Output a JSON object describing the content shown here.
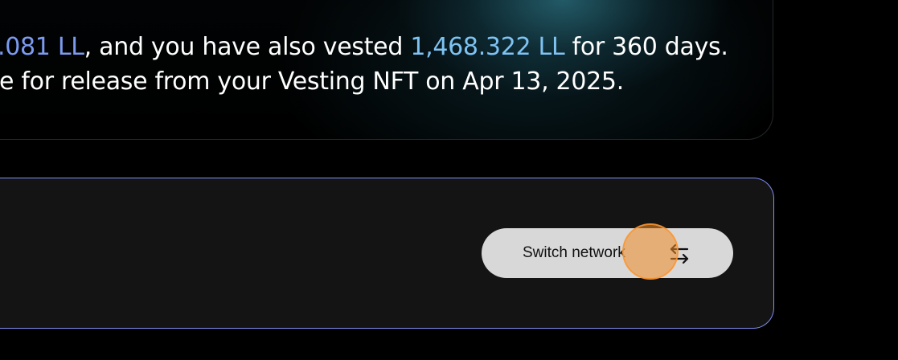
{
  "vesting_info": {
    "line1": {
      "amount_a": ".081 LL",
      "text_a": ", and you have also vested ",
      "amount_b": "1,468.322 LL",
      "text_b": " for 360 days."
    },
    "line2": {
      "text": "e for release from your Vesting NFT on Apr 13, 2025."
    }
  },
  "network": {
    "switch_label": "Switch network",
    "switch_icon": "swap-arrows-icon"
  },
  "colors": {
    "highlight_teal": "#7ec3f2",
    "highlight_blue": "#7c9bf0",
    "panel_border": "#7f8ef5",
    "button_bg": "#d8d8d8"
  }
}
